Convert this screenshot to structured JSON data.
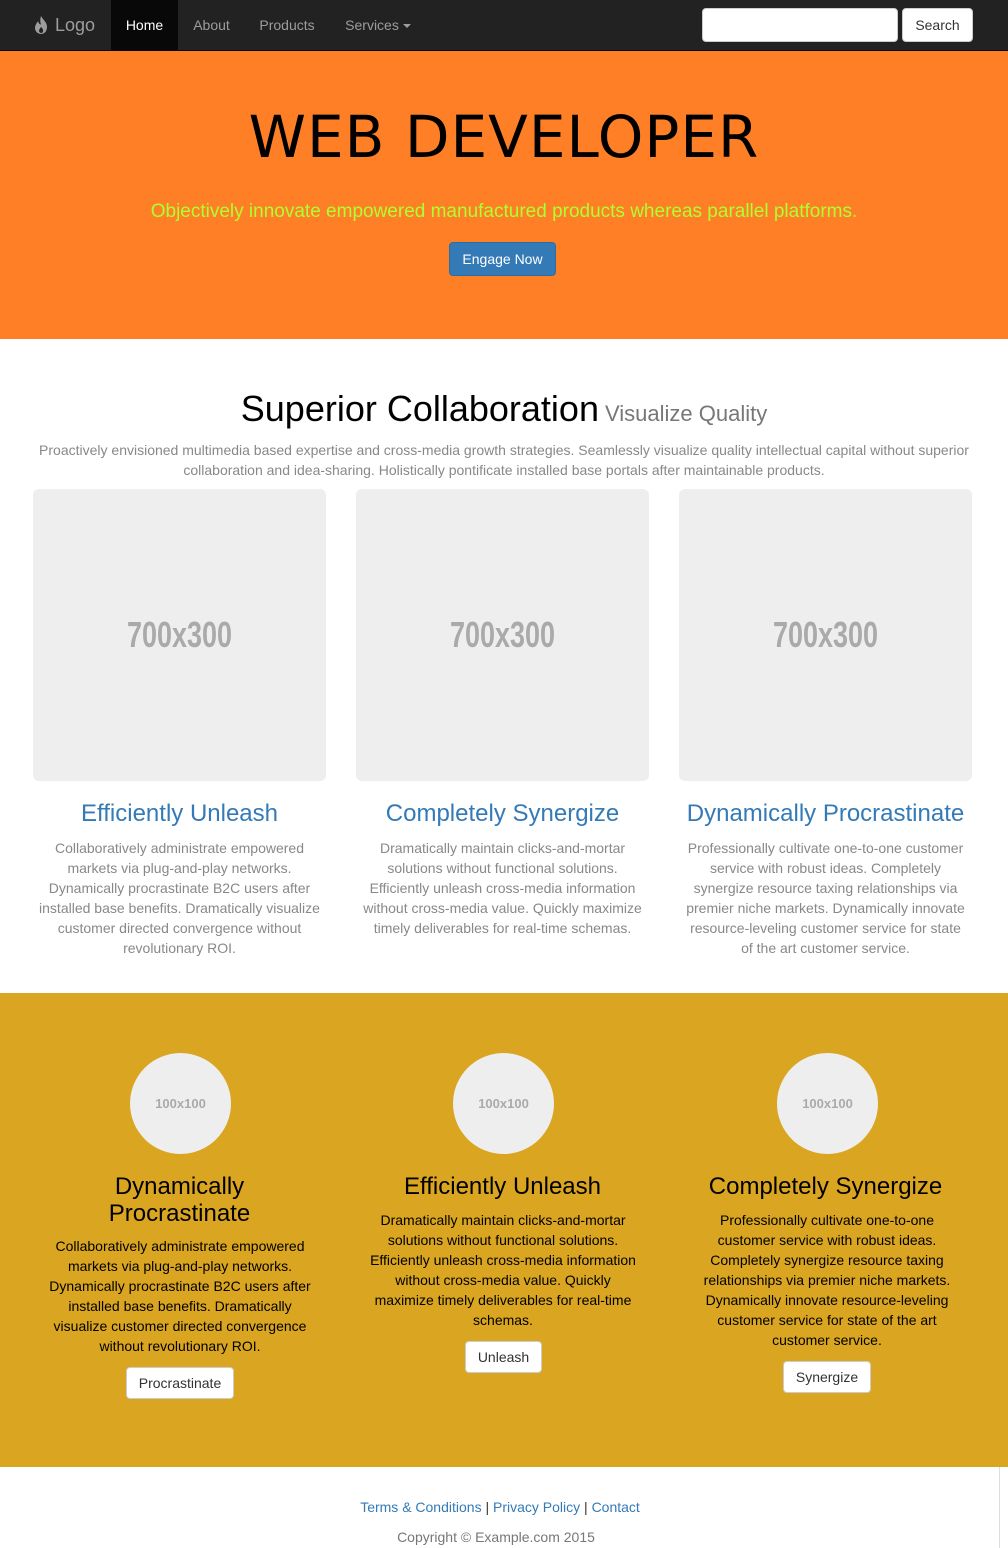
{
  "navbar": {
    "brand": "Logo",
    "items": [
      {
        "label": "Home",
        "active": true
      },
      {
        "label": "About"
      },
      {
        "label": "Products"
      },
      {
        "label": "Services"
      }
    ],
    "search_value": "",
    "search_button": "Search"
  },
  "hero": {
    "title": "WEB DEVELOPER",
    "subtitle": "Objectively innovate empowered manufactured products whereas parallel platforms.",
    "button": "Engage Now"
  },
  "features": {
    "title": "Superior Collaboration",
    "title_small": "Visualize Quality",
    "lead": "Proactively envisioned multimedia based expertise and cross-media growth strategies. Seamlessly visualize quality intellectual capital without superior collaboration and idea-sharing. Holistically pontificate installed base portals after maintainable products.",
    "columns": [
      {
        "image_label": "700x300",
        "title": "Efficiently Unleash",
        "text": "Collaboratively administrate empowered markets via plug-and-play networks. Dynamically procrastinate B2C users after installed base benefits. Dramatically visualize customer directed convergence without revolutionary ROI."
      },
      {
        "image_label": "700x300",
        "title": "Completely Synergize",
        "text": "Dramatically maintain clicks-and-mortar solutions without functional solutions. Efficiently unleash cross-media information without cross-media value. Quickly maximize timely deliverables for real-time schemas."
      },
      {
        "image_label": "700x300",
        "title": "Dynamically Procrastinate",
        "text": "Professionally cultivate one-to-one customer service with robust ideas. Completely synergize resource taxing relationships via premier niche markets. Dynamically innovate resource-leveling customer service for state of the art customer service."
      }
    ]
  },
  "highlights": {
    "background": "#daa520",
    "columns": [
      {
        "image_label": "100x100",
        "title": "Dynamically Procrastinate",
        "text": "Collaboratively administrate empowered markets via plug-and-play networks. Dynamically procrastinate B2C users after installed base benefits. Dramatically visualize customer directed convergence without revolutionary ROI.",
        "button": "Procrastinate"
      },
      {
        "image_label": "100x100",
        "title": "Efficiently Unleash",
        "text": "Dramatically maintain clicks-and-mortar solutions without functional solutions. Efficiently unleash cross-media information without cross-media value. Quickly maximize timely deliverables for real-time schemas.",
        "button": "Unleash"
      },
      {
        "image_label": "100x100",
        "title": "Completely Synergize",
        "text": "Professionally cultivate one-to-one customer service with robust ideas. Completely synergize resource taxing relationships via premier niche markets. Dynamically innovate resource-leveling customer service for state of the art customer service.",
        "button": "Synergize"
      }
    ]
  },
  "footer": {
    "links": [
      "Terms & Conditions",
      "Privacy Policy",
      "Contact"
    ],
    "separator": "|",
    "copyright": "Copyright © Example.com 2015"
  },
  "colors": {
    "navbar": "#222222",
    "hero": "#ff7f27",
    "hero_subtitle": "#adff2f",
    "primary": "#337ab7",
    "gold": "#daa520"
  }
}
